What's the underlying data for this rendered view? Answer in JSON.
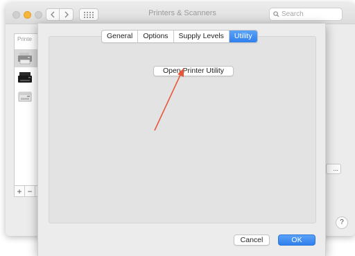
{
  "window": {
    "title": "Printers & Scanners",
    "search_placeholder": "Search"
  },
  "printer_list": {
    "header": "Printe",
    "items": [
      {
        "icon": "printer-icon",
        "selected": true
      },
      {
        "icon": "laser-printer-icon",
        "selected": false
      },
      {
        "icon": "inkjet-printer-icon",
        "selected": false
      }
    ],
    "add_label": "+",
    "remove_label": "−"
  },
  "background": {
    "right_button_label": "...",
    "help_label": "?"
  },
  "sheet": {
    "tabs": [
      {
        "label": "General",
        "active": false
      },
      {
        "label": "Options",
        "active": false
      },
      {
        "label": "Supply Levels",
        "active": false
      },
      {
        "label": "Utility",
        "active": true
      }
    ],
    "open_utility_label": "Open Printer Utility",
    "cancel_label": "Cancel",
    "ok_label": "OK"
  },
  "colors": {
    "accent": "#2f80ee",
    "annotation_arrow": "#e8563a"
  }
}
